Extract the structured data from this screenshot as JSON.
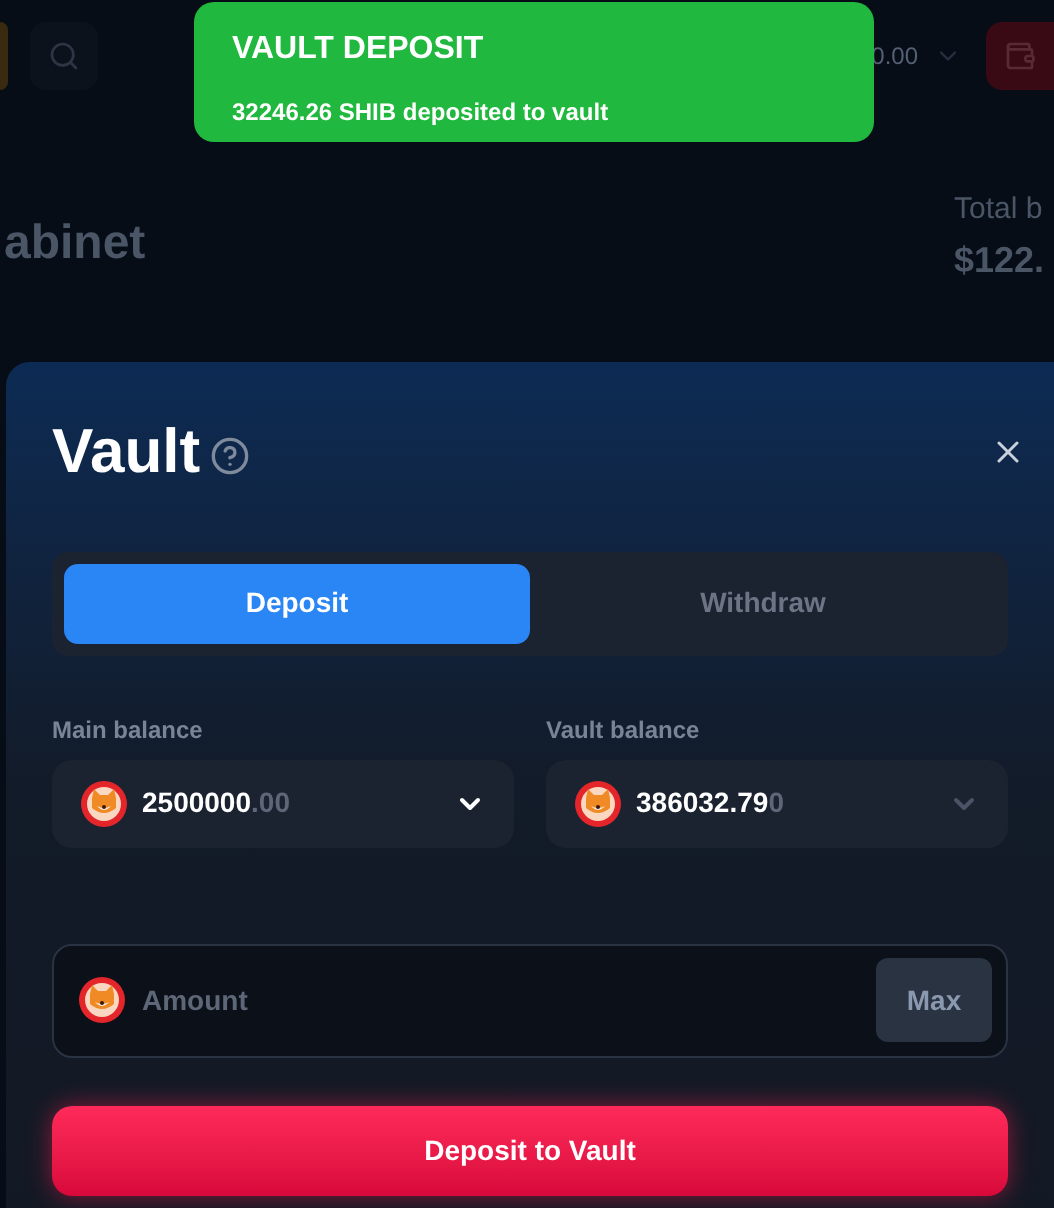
{
  "background": {
    "page_title": "abinet",
    "total_label": "Total b",
    "total_value": "$122.",
    "header_balance": "0.00"
  },
  "toast": {
    "title": "VAULT DEPOSIT",
    "message": "32246.26 SHIB deposited to vault"
  },
  "modal": {
    "title": "Vault",
    "tabs": [
      {
        "label": "Deposit",
        "selected": true
      },
      {
        "label": "Withdraw",
        "selected": false
      }
    ],
    "balances": [
      {
        "label": "Main balance",
        "value": "2500000",
        "decimals": ".00",
        "disabled": false
      },
      {
        "label": "Vault balance",
        "value": "386032.79",
        "decimals": "0",
        "disabled": true
      }
    ],
    "amount": {
      "placeholder": "Amount",
      "max_label": "Max"
    },
    "submit": "Deposit to Vault"
  }
}
